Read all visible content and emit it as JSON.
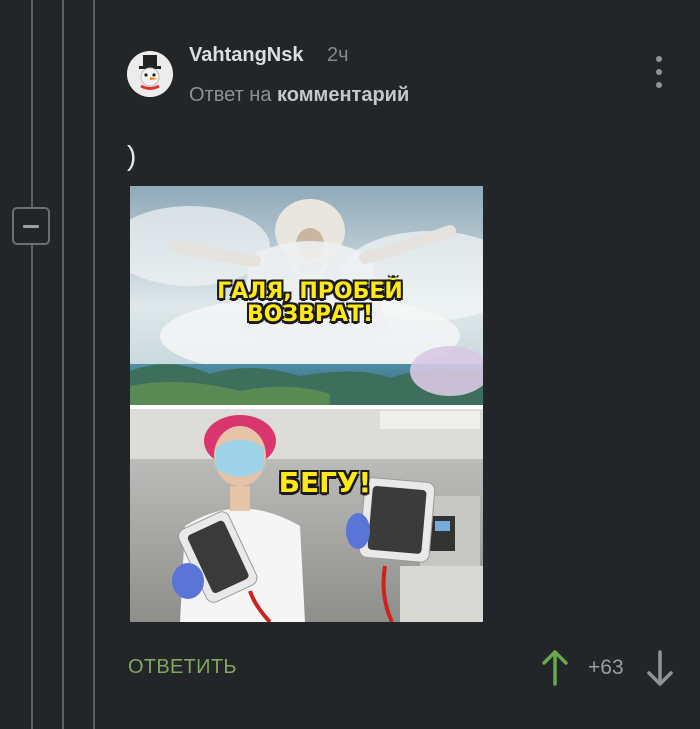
{
  "comment": {
    "username": "VahtangNsk",
    "time": "2ч",
    "reply_prefix": "Ответ на",
    "reply_target": "комментарий",
    "text": ")"
  },
  "meme": {
    "caption_top": "ГАЛЯ, ПРОБЕЙ ВОЗВРАТ!",
    "caption_bottom": "БЕГУ!"
  },
  "actions": {
    "reply_label": "ОТВЕТИТЬ",
    "score": "+63"
  },
  "colors": {
    "background": "#232629",
    "reply_accent": "#7fa760",
    "upvote": "#6aa84f"
  },
  "icons": {
    "collapse": "minus-icon",
    "menu": "kebab-menu-icon",
    "upvote": "arrow-up-icon",
    "downvote": "arrow-down-icon"
  }
}
